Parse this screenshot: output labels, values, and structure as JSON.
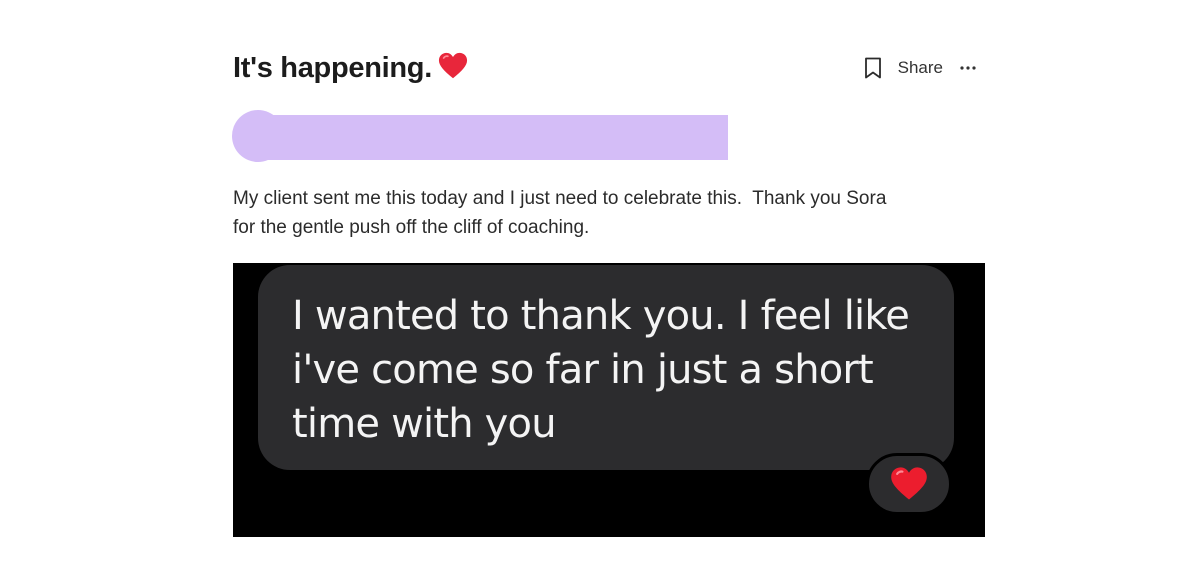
{
  "post": {
    "title": "It's happening.",
    "title_emoji": "red-heart",
    "body": "My client sent me this today and I just need to celebrate this.  Thank you Sora\nfor the gentle push off the cliff of coaching."
  },
  "actions": {
    "bookmark_icon": "bookmark-icon",
    "share_label": "Share",
    "more_icon": "more-horizontal-icon"
  },
  "author": {
    "redacted": true,
    "redaction_color": "#d4bdf7"
  },
  "attachment": {
    "message_text": "I wanted to thank you. I feel like i've come so far in just a short time with you",
    "reaction_emoji": "red-heart",
    "bubble_color": "#2c2c2e",
    "background_color": "#000000"
  },
  "colors": {
    "heart": "#e8263b",
    "title": "#1c1c1c"
  }
}
